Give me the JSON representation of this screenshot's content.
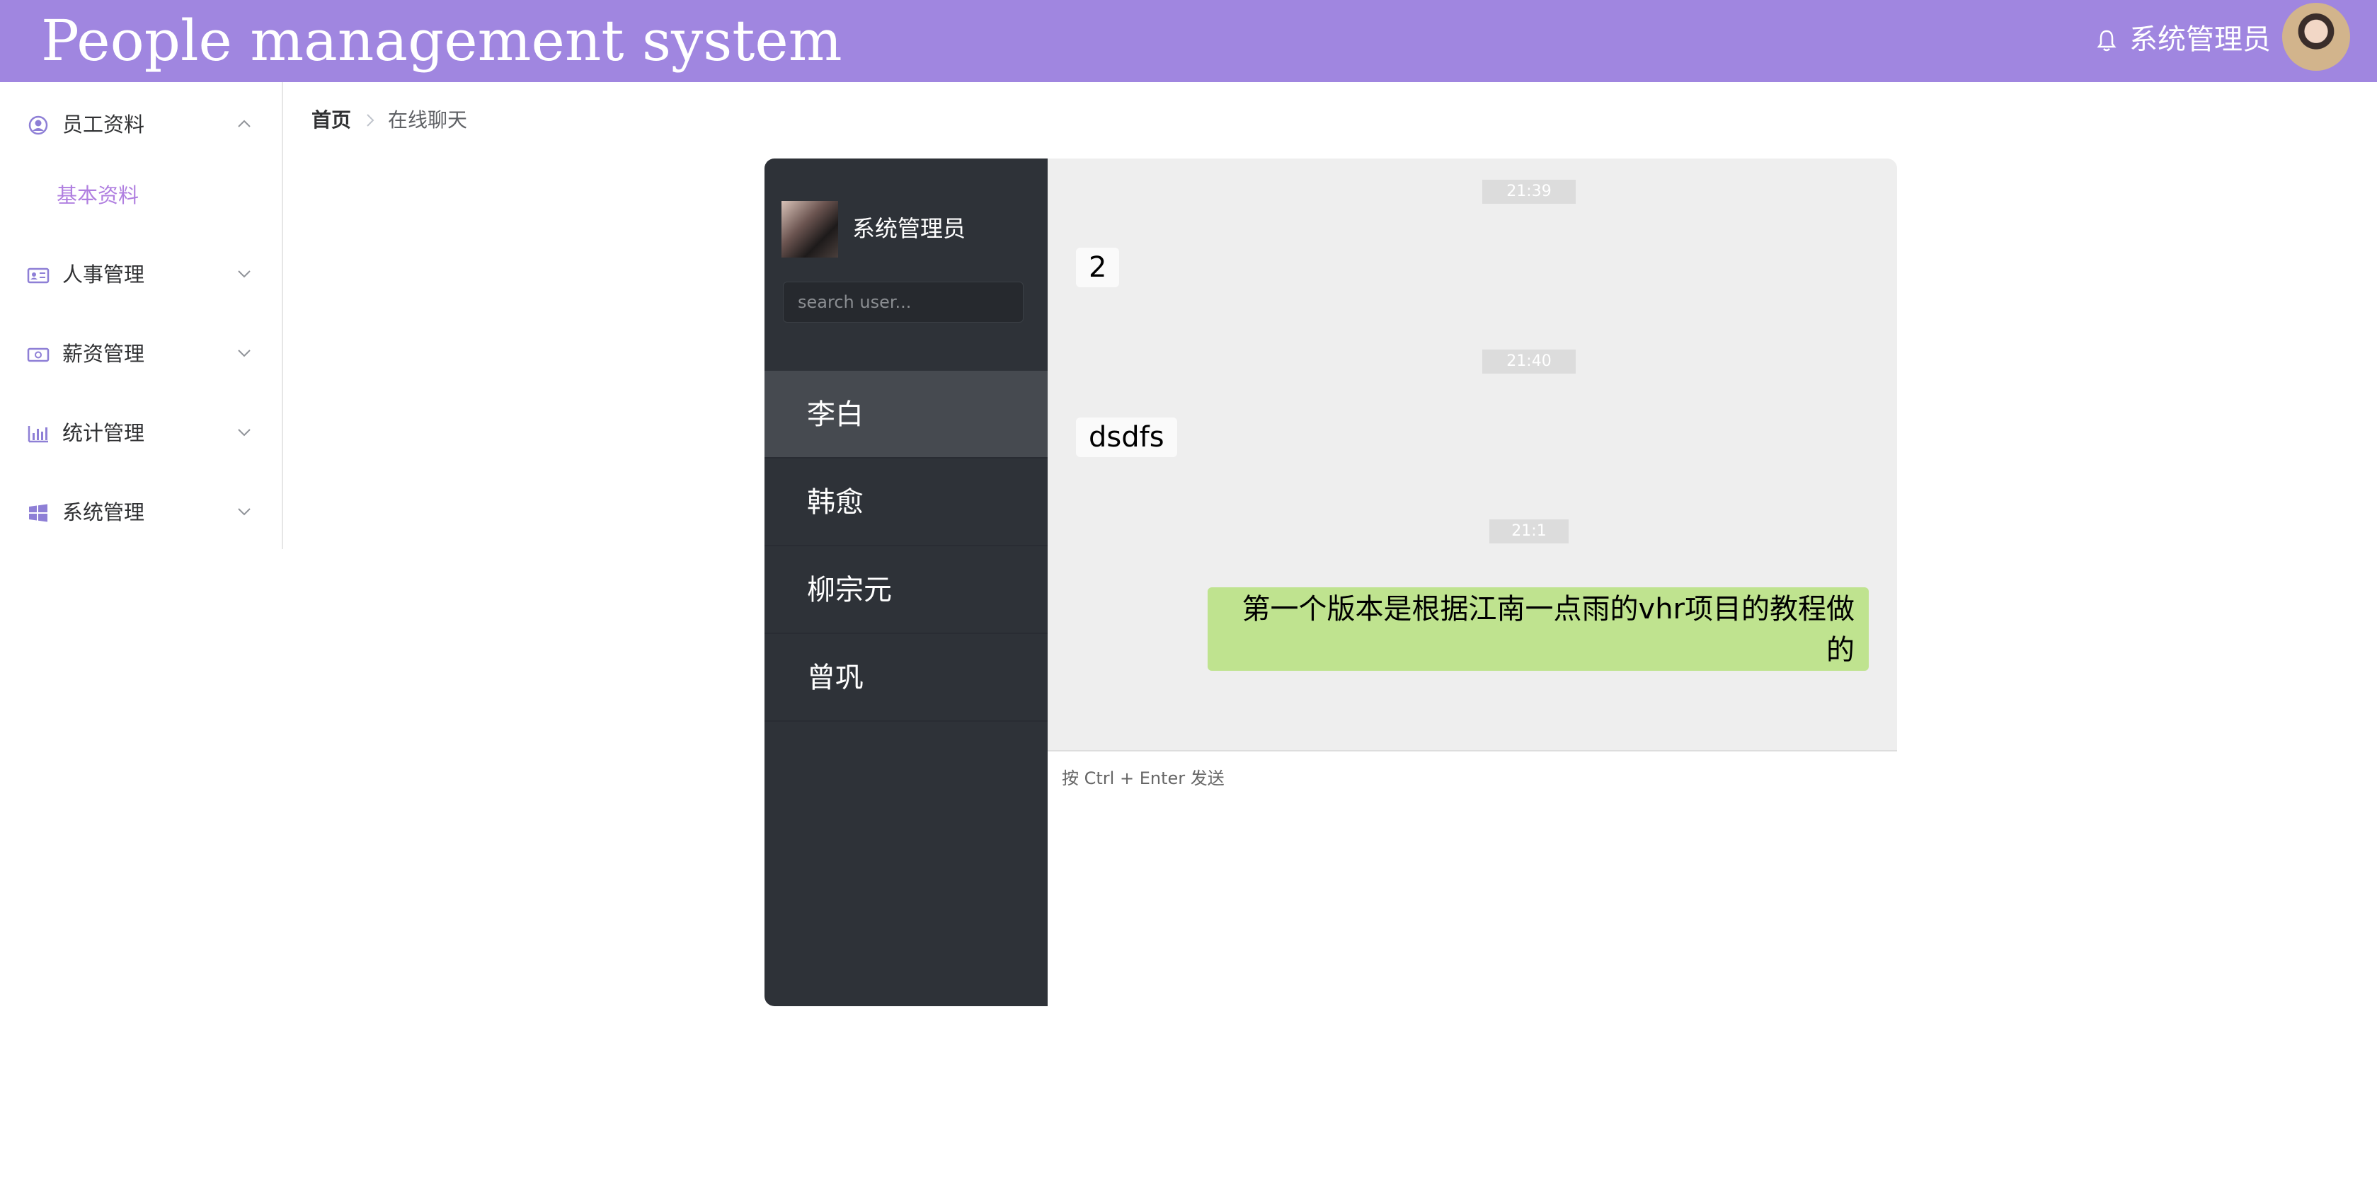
{
  "header": {
    "title": "People management system",
    "user_name": "系统管理员",
    "bell_icon": "bell-icon",
    "color": "#a086e0"
  },
  "sidebar": {
    "menus": [
      {
        "label": "员工资料",
        "icon": "user-circle-icon",
        "expanded": true,
        "children": [
          {
            "label": "基本资料",
            "active": true
          }
        ]
      },
      {
        "label": "人事管理",
        "icon": "id-card-icon",
        "expanded": false
      },
      {
        "label": "薪资管理",
        "icon": "money-icon",
        "expanded": false
      },
      {
        "label": "统计管理",
        "icon": "bar-chart-icon",
        "expanded": false
      },
      {
        "label": "系统管理",
        "icon": "windows-icon",
        "expanded": false
      }
    ]
  },
  "breadcrumb": {
    "home": "首页",
    "current": "在线聊天"
  },
  "chat": {
    "current_user": "系统管理员",
    "search_placeholder": "search user...",
    "contacts": [
      {
        "name": "李白",
        "active": true
      },
      {
        "name": "韩愈",
        "active": false
      },
      {
        "name": "柳宗元",
        "active": false
      },
      {
        "name": "曾巩",
        "active": false
      }
    ],
    "messages": [
      {
        "time": "21:39",
        "text": "2",
        "self": false
      },
      {
        "time": "21:40",
        "text": "dsdfs",
        "self": false
      },
      {
        "time": "21:1",
        "text": "第一个版本是根据江南一点雨的vhr项目的教程做的",
        "self": true
      }
    ],
    "input_hint": "按 Ctrl + Enter 发送",
    "self_bubble_color": "#bfe38f"
  }
}
